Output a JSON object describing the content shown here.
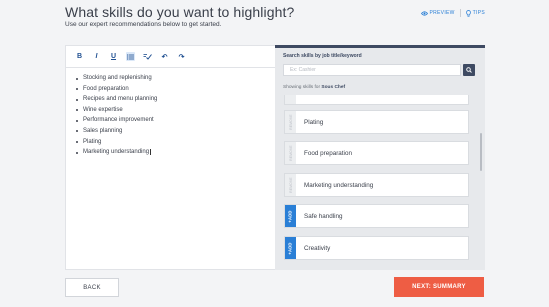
{
  "header": {
    "title": "What skills do you want to highlight?",
    "subtitle": "Use our expert recommendations below to get started.",
    "preview_label": "PREVIEW",
    "tips_label": "TIPS"
  },
  "toolbar": {
    "bold": "B",
    "italic": "I",
    "underline": "U",
    "undo": "↶",
    "redo": "↷"
  },
  "editor": {
    "items": [
      "Stocking and replenishing",
      "Food preparation",
      "Recipes and menu planning",
      "Wine expertise",
      "Performance improvement",
      "Sales planning",
      "Plating",
      "Marketing understanding"
    ]
  },
  "search": {
    "label": "Search skills by job title/keyword",
    "placeholder": "Ex: Cashier",
    "showing_prefix": "Showing skills for",
    "showing_job": "Sous Chef"
  },
  "skills": [
    {
      "label": "Plating",
      "tab": "REMOVE",
      "added": true
    },
    {
      "label": "Food preparation",
      "tab": "REMOVE",
      "added": true
    },
    {
      "label": "Marketing understanding",
      "tab": "REMOVE",
      "added": true
    },
    {
      "label": "Safe handling",
      "tab": "+ADD",
      "added": false
    },
    {
      "label": "Creativity",
      "tab": "+ADD",
      "added": false
    }
  ],
  "footer": {
    "back_label": "BACK",
    "next_label": "NEXT: SUMMARY"
  },
  "colors": {
    "accent_blue": "#2a7fd6",
    "navy": "#3e4a62",
    "cta": "#ee5d44"
  }
}
